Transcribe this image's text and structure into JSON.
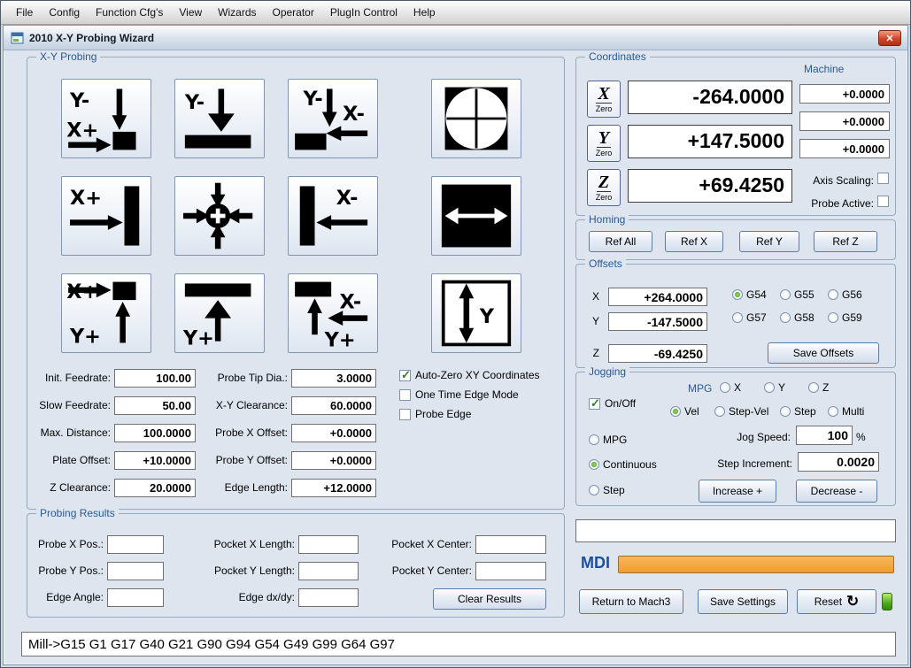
{
  "menu": {
    "items": [
      "File",
      "Config",
      "Function Cfg's",
      "View",
      "Wizards",
      "Operator",
      "PlugIn Control",
      "Help"
    ]
  },
  "window": {
    "title": "2010 X-Y Probing Wizard"
  },
  "icons": {
    "close": "✕",
    "reset_arrow": "↻"
  },
  "probing": {
    "group_label": "X-Y Probing",
    "buttons": [
      {
        "labels": [
          "Y-",
          "X+"
        ]
      },
      {
        "labels": [
          "Y-"
        ]
      },
      {
        "labels": [
          "Y-",
          "X-"
        ]
      },
      {
        "labels": []
      },
      {
        "labels": [
          "X+"
        ]
      },
      {
        "labels": []
      },
      {
        "labels": [
          "X-"
        ]
      },
      {
        "labels": []
      },
      {
        "labels": [
          "X+",
          "Y+"
        ]
      },
      {
        "labels": [
          "Y+"
        ]
      },
      {
        "labels": [
          "X-",
          "Y+"
        ]
      },
      {
        "labels": [
          "Y"
        ]
      }
    ],
    "fields_left": [
      {
        "label": "Init. Feedrate:",
        "value": "100.00"
      },
      {
        "label": "Slow Feedrate:",
        "value": "50.00"
      },
      {
        "label": "Max. Distance:",
        "value": "100.0000"
      },
      {
        "label": "Plate Offset:",
        "value": "+10.0000"
      },
      {
        "label": "Z Clearance:",
        "value": "20.0000"
      }
    ],
    "fields_mid": [
      {
        "label": "Probe Tip Dia.:",
        "value": "3.0000"
      },
      {
        "label": "X-Y Clearance:",
        "value": "60.0000"
      },
      {
        "label": "Probe X Offset:",
        "value": "+0.0000"
      },
      {
        "label": "Probe Y Offset:",
        "value": "+0.0000"
      },
      {
        "label": "Edge Length:",
        "value": "+12.0000"
      }
    ],
    "checkboxes": [
      {
        "label": "Auto-Zero XY Coordinates",
        "checked": true
      },
      {
        "label": "One Time Edge Mode",
        "checked": false
      },
      {
        "label": "Probe Edge",
        "checked": false
      }
    ]
  },
  "results": {
    "group_label": "Probing Results",
    "col1": [
      {
        "label": "Probe X Pos.:",
        "value": ""
      },
      {
        "label": "Probe Y Pos.:",
        "value": ""
      },
      {
        "label": "Edge Angle:",
        "value": ""
      }
    ],
    "col2": [
      {
        "label": "Pocket X Length:",
        "value": ""
      },
      {
        "label": "Pocket Y Length:",
        "value": ""
      },
      {
        "label": "Edge dx/dy:",
        "value": ""
      }
    ],
    "col3": [
      {
        "label": "Pocket X Center:",
        "value": ""
      },
      {
        "label": "Pocket Y Center:",
        "value": ""
      }
    ],
    "clear_button": "Clear Results"
  },
  "coordinates": {
    "group_label": "Coordinates",
    "machine_label": "Machine",
    "axes": [
      {
        "letter": "X",
        "zero_label": "Zero",
        "dro": "-264.0000",
        "machine": "+0.0000"
      },
      {
        "letter": "Y",
        "zero_label": "Zero",
        "dro": "+147.5000",
        "machine": "+0.0000"
      },
      {
        "letter": "Z",
        "zero_label": "Zero",
        "dro": "+69.4250",
        "machine": "+0.0000"
      }
    ],
    "axis_scaling_label": "Axis Scaling:",
    "probe_active_label": "Probe Active:"
  },
  "homing": {
    "group_label": "Homing",
    "buttons": [
      "Ref All",
      "Ref X",
      "Ref Y",
      "Ref Z"
    ]
  },
  "offsets": {
    "group_label": "Offsets",
    "rows": [
      {
        "letter": "X",
        "value": "+264.0000"
      },
      {
        "letter": "Y",
        "value": "-147.5000"
      },
      {
        "letter": "Z",
        "value": "-69.4250"
      }
    ],
    "radios_row1": [
      {
        "label": "G54",
        "selected": true
      },
      {
        "label": "G55",
        "selected": false
      },
      {
        "label": "G56",
        "selected": false
      }
    ],
    "radios_row2": [
      {
        "label": "G57",
        "selected": false
      },
      {
        "label": "G58",
        "selected": false
      },
      {
        "label": "G59",
        "selected": false
      }
    ],
    "save_button": "Save Offsets"
  },
  "jogging": {
    "group_label": "Jogging",
    "onoff_label": "On/Off",
    "mpg_header": "MPG",
    "axis_radios": [
      {
        "label": "X",
        "selected": false
      },
      {
        "label": "Y",
        "selected": false
      },
      {
        "label": "Z",
        "selected": false
      }
    ],
    "mode_radios": [
      {
        "label": "Vel",
        "selected": true
      },
      {
        "label": "Step-Vel",
        "selected": false
      },
      {
        "label": "Step",
        "selected": false
      },
      {
        "label": "Multi",
        "selected": false
      }
    ],
    "type_radios": [
      {
        "label": "MPG",
        "selected": false
      },
      {
        "label": "Continuous",
        "selected": true
      },
      {
        "label": "Step",
        "selected": false
      }
    ],
    "jog_speed_label": "Jog Speed:",
    "jog_speed_value": "100",
    "jog_speed_unit": "%",
    "step_increment_label": "Step Increment:",
    "step_increment_value": "0.0020",
    "increase_button": "Increase +",
    "decrease_button": "Decrease -"
  },
  "mdi": {
    "history_value": "",
    "label": "MDI",
    "input_value": ""
  },
  "footer": {
    "return_button": "Return to Mach3",
    "save_button": "Save Settings",
    "reset_button": "Reset"
  },
  "status": {
    "text": "Mill->G15  G1 G17 G40 G21 G90 G94 G54 G49 G99 G64 G97"
  }
}
